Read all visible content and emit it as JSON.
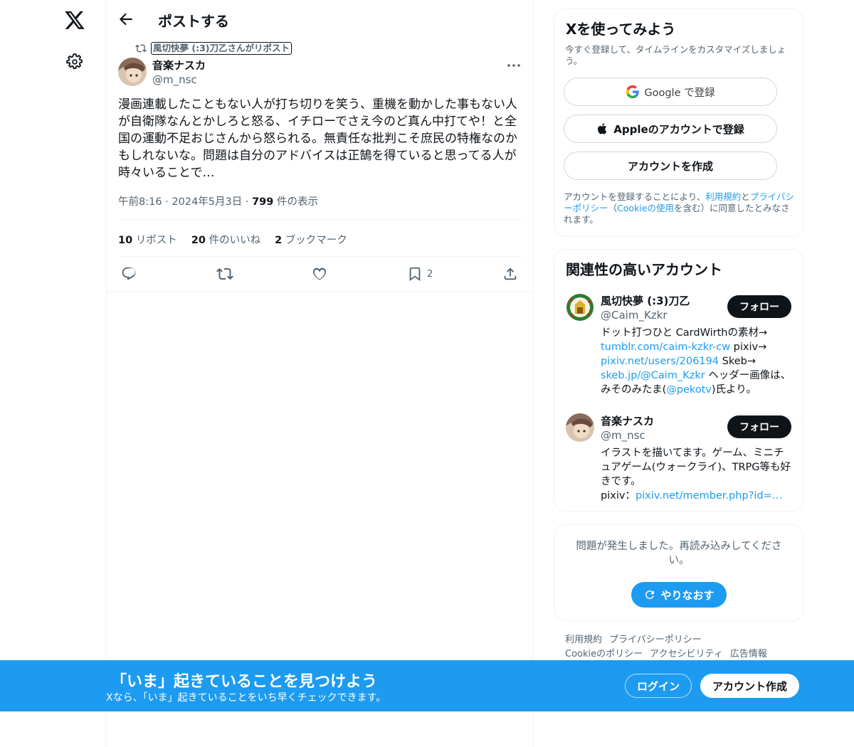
{
  "header": {
    "title": "ポストする"
  },
  "post": {
    "repost_label": "風切快夢 (:3)刀乙さんがリポスト",
    "author_name": "音楽ナスカ",
    "author_handle": "@m_nsc",
    "text": "漫画連載したこともない人が打ち切りを笑う、重機を動かした事もない人が自衛隊なんとかしろと怒る、イチローでさえ今のど真ん中打てや！と全国の運動不足おじさんから怒られる。無責任な批判こそ庶民の特権なのかもしれないな。問題は自分のアドバイスは正鵠を得ていると思ってる人が時々いることで…",
    "time": "午前8:16",
    "date": "2024年5月3日",
    "sep": "·",
    "views_count": "799",
    "views_label": " 件の表示",
    "stats": {
      "reposts_count": "10",
      "reposts_label": " リポスト",
      "likes_count": "20",
      "likes_label": " 件のいいね",
      "bookmarks_count": "2",
      "bookmarks_label": " ブックマーク"
    },
    "bookmark_action_count": "2"
  },
  "signup": {
    "title": "Xを使ってみよう",
    "subtitle": "今すぐ登録して、タイムラインをカスタマイズしましょう。",
    "google_label": "Google で登録",
    "apple_label": "Appleのアカウントで登録",
    "create_label": "アカウントを作成",
    "terms_prefix": "アカウントを登録することにより、",
    "terms_link": "利用規約",
    "terms_and": "と",
    "privacy_link": "プライバシーポリシー",
    "terms_paren_open": "（",
    "cookie_link": "Cookieの使用",
    "terms_suffix": "を含む）に同意したとみなされます。"
  },
  "related": {
    "title": "関連性の高いアカウント",
    "follow_label": "フォロー",
    "accounts": [
      {
        "name": "風切快夢 (:3)刀乙",
        "handle": "@Caim_Kzkr",
        "bio_1": "ドット打つひと CardWirthの素材→ ",
        "link_1": "tumblr.com/caim-kzkr-cw",
        "bio_2": " pixiv→ ",
        "link_2": "pixiv.net/users/206194",
        "bio_3": " Skeb→ ",
        "link_3": "skeb.jp/@Caim_Kzkr",
        "bio_4": " ヘッダー画像は、みそのみたま(",
        "link_4": "@pekotv",
        "bio_5": ")氏より。"
      },
      {
        "name": "音楽ナスカ",
        "handle": "@m_nsc",
        "bio_1": "イラストを描いてます。ゲーム、ミニチュアゲーム(ウォークライ)、TRPG等も好きです。",
        "bio_2": "pixiv：",
        "link_1": "pixiv.net/member.php?id=…"
      }
    ]
  },
  "error": {
    "text": "問題が発生しました。再読み込みしてください。",
    "retry_label": "やりなおす"
  },
  "footer": {
    "links": [
      "利用規約",
      "プライバシーポリシー",
      "Cookieのポリシー",
      "アクセシビリティ",
      "広告情報"
    ]
  },
  "banner": {
    "title": "「いま」起きていることを見つけよう",
    "subtitle": "Xなら、「いま」起きていることをいち早くチェックできます。",
    "login_label": "ログイン",
    "signup_label": "アカウント作成"
  },
  "colors": {
    "accent": "#1d9bf0",
    "text": "#0f1419",
    "muted": "#536471",
    "border": "#eff3f4"
  }
}
